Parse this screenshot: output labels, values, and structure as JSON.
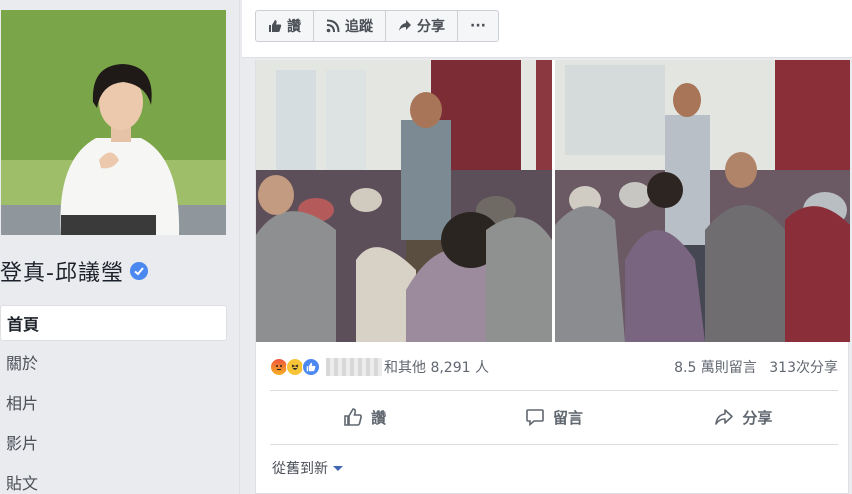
{
  "sidebar": {
    "page_name": "登真-邱議瑩",
    "nav": [
      {
        "label": "首頁",
        "active": true
      },
      {
        "label": "關於"
      },
      {
        "label": "相片"
      },
      {
        "label": "影片"
      },
      {
        "label": "貼文"
      }
    ]
  },
  "action_bar": {
    "like": "讚",
    "follow": "追蹤",
    "share": "分享",
    "more": "···"
  },
  "post": {
    "reactions": [
      "angry",
      "haha",
      "like"
    ],
    "reaction_summary": "和其他 8,291 人",
    "comments": "8.5 萬則留言",
    "shares": "313次分享",
    "actions": {
      "like": "讚",
      "comment": "留言",
      "share": "分享"
    },
    "comment_sort": "從舊到新"
  },
  "colors": {
    "accent": "#4267b2",
    "verified": "#4b88f0",
    "background": "#e9ebee"
  }
}
